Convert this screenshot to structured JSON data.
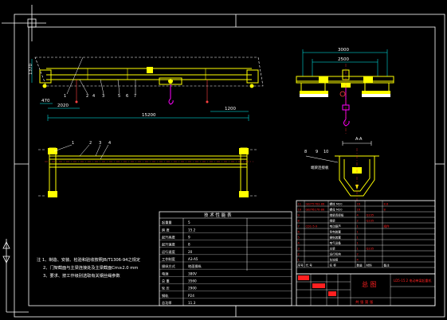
{
  "drawing": {
    "background": "#000000",
    "colors": {
      "frame": "#ffffff",
      "outline": "#ffffff",
      "structure": "#ffff00",
      "parts": "#ffff00",
      "hook": "#ff00ff",
      "dimension": "#00ffff",
      "center_line": "#ff3030",
      "table_red": "#ff2020",
      "table_text": "#ffffff",
      "leader": "#ff4040"
    }
  },
  "elevation": {
    "dim_total": "15200",
    "dim_left_end": "2020",
    "dim_right_end": "1200",
    "dim_left_small": "470",
    "height_label": "1370",
    "callouts": [
      "1",
      "2",
      "3",
      "4",
      "5",
      "6",
      "7"
    ]
  },
  "end_view": {
    "dim_outer": "3000",
    "dim_inner": "2500"
  },
  "plan_view": {
    "callouts": [
      "1",
      "2",
      "3",
      "4"
    ]
  },
  "section": {
    "label": "A-A",
    "callouts": [
      "8",
      "9",
      "10"
    ],
    "note": "端梁连接板"
  },
  "notes": {
    "line1": "注 1、制造、安装、检验和验收按照JB/T1306-94之规定",
    "line2": "2、门架截面与主梁连接处及主梁截面Cm≥2.0 mm",
    "line3": "3、要求、按工作级别选取有关钢丝绳参数"
  },
  "spec_table": {
    "title": "技 术 性 能 表",
    "rows": [
      {
        "label": "起重量",
        "value": "5"
      },
      {
        "label": "跨 度",
        "value": "15.2"
      },
      {
        "label": "起升高度",
        "value": "9"
      },
      {
        "label": "起升速度",
        "value": "8"
      },
      {
        "label": "运行速度",
        "value": "20"
      },
      {
        "label": "工作制度",
        "value": "A3-A5"
      },
      {
        "label": "操纵方式",
        "value": "地面操纵"
      },
      {
        "label": "电源",
        "value": "380V"
      },
      {
        "label": "总 重",
        "value": "3560"
      },
      {
        "label": "轮 压",
        "value": "2900"
      },
      {
        "label": "钢轨",
        "value": "P24"
      },
      {
        "label": "总功率",
        "value": "11.3"
      }
    ]
  },
  "parts_table": {
    "rows": [
      [
        "11",
        "GB/T5783-86",
        "螺栓 M20",
        "16",
        "",
        "8.8"
      ],
      [
        "10",
        "GB/T6170-86",
        "螺母 M20",
        "16",
        "",
        "8"
      ],
      [
        "9",
        "",
        "端梁连接板",
        "4",
        "Q235",
        ""
      ],
      [
        "8",
        "",
        "端梁",
        "2",
        "Q235",
        ""
      ],
      [
        "7",
        "CD1-5-9",
        "电动葫芦",
        "1",
        "",
        "组件"
      ],
      [
        "6",
        "",
        "导电装置",
        "1",
        "",
        ""
      ],
      [
        "5",
        "",
        "操纵装置",
        "1",
        "",
        ""
      ],
      [
        "4",
        "",
        "电气设备",
        "1",
        "",
        ""
      ],
      [
        "3",
        "",
        "主梁",
        "1",
        "Q235",
        ""
      ],
      [
        "2",
        "",
        "运行机构",
        "2",
        "",
        ""
      ],
      [
        "1",
        "",
        "车轮组",
        "4",
        "",
        ""
      ]
    ],
    "header": [
      "序号",
      "代 号",
      "名 称",
      "数量",
      "材料",
      "备注"
    ]
  },
  "title_block": {
    "title": "总 图",
    "subtitle": "LD5-15.2 电动单梁起重机",
    "sheet": "共 张 第 张"
  }
}
